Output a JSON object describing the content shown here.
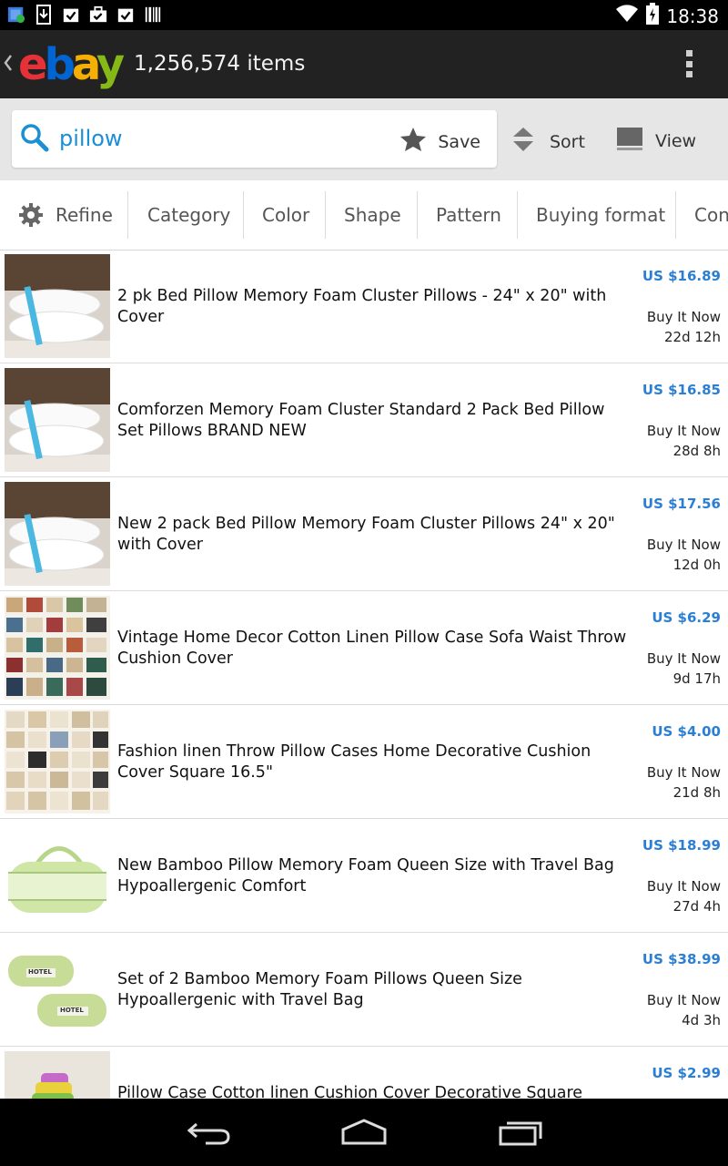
{
  "status_bar": {
    "time": "18:38",
    "icons": [
      "shield-app-icon",
      "download-icon",
      "clipboard-check-icon",
      "briefcase-check-icon",
      "clipboard-check-icon",
      "barcode-icon",
      "wifi-icon",
      "battery-charging-icon"
    ]
  },
  "app_bar": {
    "logo_letters": [
      "e",
      "b",
      "a",
      "y"
    ],
    "logo_colors": [
      "#e53238",
      "#0064d2",
      "#f5af02",
      "#86b817"
    ],
    "items_count": "1,256,574 items"
  },
  "search": {
    "query": "pillow",
    "save_label": "Save",
    "sort_label": "Sort",
    "view_label": "View"
  },
  "filters": [
    "Refine",
    "Category",
    "Color",
    "Shape",
    "Pattern",
    "Buying format",
    "Con"
  ],
  "listings": [
    {
      "title": "2 pk Bed Pillow Memory Foam Cluster Pillows - 24\" x 20\" with Cover",
      "price": "US $16.89",
      "format": "Buy It Now",
      "time_left": "22d 12h",
      "thumb": "pillows"
    },
    {
      "title": "Comforzen Memory Foam Cluster Standard 2 Pack Bed Pillow Set Pillows BRAND NEW",
      "price": "US $16.85",
      "format": "Buy It Now",
      "time_left": "28d 8h",
      "thumb": "pillows"
    },
    {
      "title": "New 2 pack Bed Pillow Memory Foam Cluster Pillows 24\" x 20\" with Cover",
      "price": "US $17.56",
      "format": "Buy It Now",
      "time_left": "12d 0h",
      "thumb": "pillows"
    },
    {
      "title": "Vintage Home Decor Cotton Linen Pillow Case Sofa Waist Throw Cushion Cover",
      "price": "US $6.29",
      "format": "Buy It Now",
      "time_left": "9d 17h",
      "thumb": "mosaic-color"
    },
    {
      "title": "Fashion linen Throw Pillow Cases Home Decorative Cushion Cover Square 16.5\"",
      "price": "US $4.00",
      "format": "Buy It Now",
      "time_left": "21d 8h",
      "thumb": "mosaic-beige"
    },
    {
      "title": "New Bamboo Pillow Memory Foam Queen Size with Travel Bag Hypoallergenic Comfort",
      "price": "US $18.99",
      "format": "Buy It Now",
      "time_left": "27d 4h",
      "thumb": "bag-single"
    },
    {
      "title": "Set of 2 Bamboo Memory Foam Pillows Queen Size Hypoallergenic with Travel Bag",
      "price": "US $38.99",
      "format": "Buy It Now",
      "time_left": "4d 3h",
      "thumb": "bag-double",
      "thumb_text": "HOTEL"
    },
    {
      "title": "Pillow Case Cotton linen Cushion Cover Decorative Square",
      "price": "US $2.99",
      "format": "",
      "time_left": "",
      "thumb": "cushions-stack"
    }
  ],
  "nav_bar": {
    "icons": [
      "back-icon",
      "home-icon",
      "recent-apps-icon"
    ]
  }
}
